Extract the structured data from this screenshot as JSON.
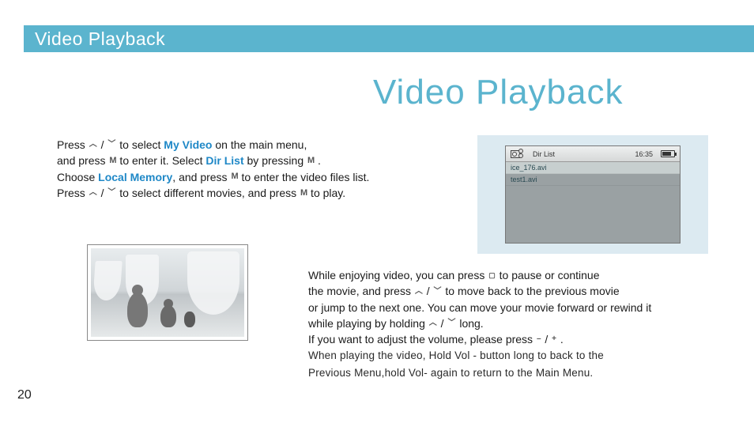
{
  "header": {
    "title": "Video Playback"
  },
  "title": "Video Playback",
  "page_number": "20",
  "highlights": {
    "my_video": "My Video",
    "dir_list": "Dir List",
    "local_memory": "Local Memory"
  },
  "para1": {
    "t1": "Press ",
    "t2": " / ",
    "t3": " to select ",
    "t4": " on the main menu,",
    "t5": "and press ",
    "t6": " to enter it. Select ",
    "t7": " by pressing ",
    "t8": " .",
    "t9": "Choose ",
    "t10": ", and press ",
    "t11": " to enter the video files list.",
    "t12": "Press ",
    "t13": " / ",
    "t14": " to select different movies, and press ",
    "t15": " to play."
  },
  "para2": {
    "t1": "While enjoying video, you can press ",
    "t2": " to pause or continue",
    "t3": "the movie, and press ",
    "t4": " / ",
    "t5": " to move back to the previous movie",
    "t6": "or jump to the next one. You can move your movie forward or rewind it",
    "t7": "while playing by holding ",
    "t8": " / ",
    "t9": " long.",
    "t10": "If you want to adjust the volume, please press ",
    "t11": " / ",
    "t12": " .",
    "hold": "When playing the video, Hold Vol - button long to back to the\nPrevious Menu,hold Vol- again to return to the Main Menu."
  },
  "device": {
    "title": "Dir List",
    "time": "16:35",
    "files": [
      "ice_176.avi",
      "test1.avi"
    ]
  }
}
